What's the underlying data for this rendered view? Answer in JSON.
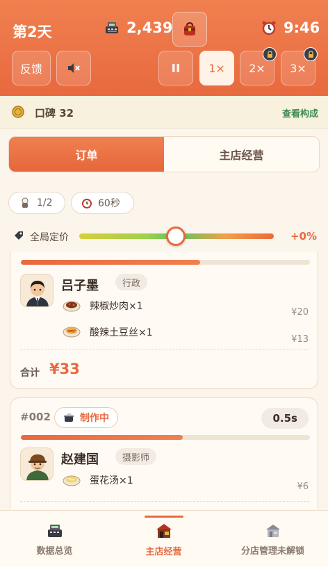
{
  "header": {
    "day": "第2天",
    "money": "2,439",
    "time": "9:46",
    "feedback_label": "反馈",
    "speeds": [
      "1×",
      "2×",
      "3×"
    ],
    "active_speed": "1×"
  },
  "reputation": {
    "text": "口碑 32",
    "link": "查看构成"
  },
  "tabs": [
    "订单",
    "主店经营"
  ],
  "filters": {
    "seats": "1/2",
    "timer": "60秒"
  },
  "pricing": {
    "label": "全局定价",
    "value": "+0%"
  },
  "orders": [
    {
      "progress": 0.62,
      "customer": "吕子墨",
      "job": "行政",
      "dishes": [
        {
          "name": "辣椒炒肉×1",
          "price": "¥20"
        },
        {
          "name": "酸辣土豆丝×1",
          "price": "¥13"
        }
      ],
      "total_label": "合计",
      "total": "¥33"
    },
    {
      "number": "#002",
      "status": "制作中",
      "time_left": "0.5s",
      "progress": 0.56,
      "customer": "赵建国",
      "job": "摄影师",
      "dishes": [
        {
          "name": "蛋花汤×1",
          "price": "¥6"
        }
      ]
    }
  ],
  "nav": [
    {
      "label": "数据总览"
    },
    {
      "label": "主店经营"
    },
    {
      "label": "分店管理未解锁"
    }
  ],
  "colors": {
    "accent": "#e8693f",
    "positive": "#3e8b54"
  }
}
